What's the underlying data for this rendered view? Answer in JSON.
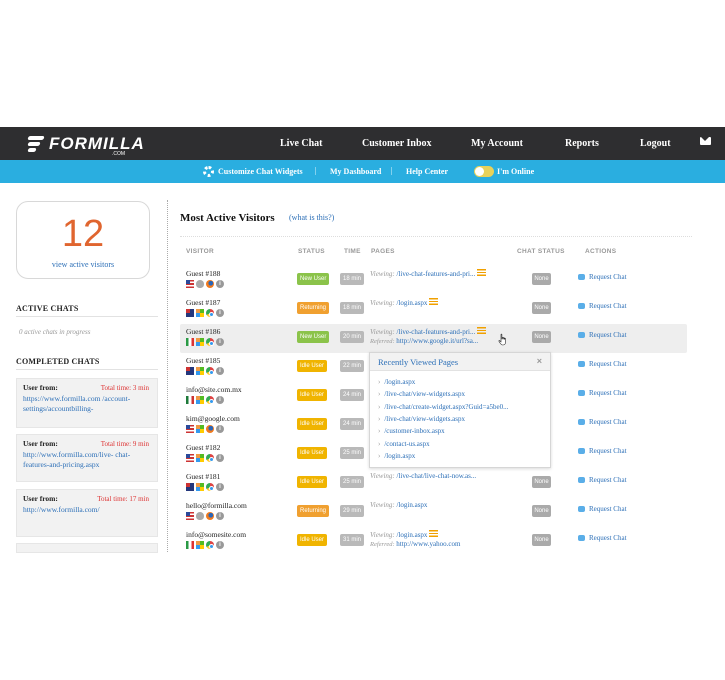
{
  "brand": {
    "name": "FORMILLA",
    "suffix": ".COM"
  },
  "topnav": [
    "Live Chat",
    "Customer Inbox",
    "My Account",
    "Reports",
    "Logout"
  ],
  "subnav": {
    "widgets": "Customize Chat Widgets",
    "dashboard": "My Dashboard",
    "help": "Help Center",
    "online": "I'm Online",
    "online_on": true
  },
  "sidebar": {
    "count": "12",
    "count_link": "view active visitors",
    "active_title": "ACTIVE CHATS",
    "active_empty": "0 active chats in progress",
    "completed_title": "COMPLETED CHATS",
    "completed": [
      {
        "label": "User from:",
        "time": "Total time: 3 min",
        "url": "https://www.formilla.com /account-settings/accountbilling-"
      },
      {
        "label": "User from:",
        "time": "Total time: 9 min",
        "url": "http://www.formilla.com/live- chat-features-and-pricing.aspx"
      },
      {
        "label": "User from:",
        "time": "Total time: 17 min",
        "url": "http://www.formilla.com/"
      }
    ]
  },
  "main": {
    "title": "Most Active Visitors",
    "help_link": "(what is this?)",
    "headers": {
      "visitor": "VISITOR",
      "status": "STATUS",
      "time": "TIME",
      "pages": "PAGES",
      "chat_status": "CHAT STATUS",
      "actions": "ACTIONS"
    },
    "viewing_label": "Viewing:",
    "referred_label": "Referred:",
    "request_label": "Request Chat",
    "rows": [
      {
        "name": "Guest #188",
        "status": "New User",
        "time": "18 min",
        "page": "/live-chat-features-and-pri...",
        "list": true,
        "referred": "",
        "chat": "None",
        "flag": "us",
        "os": "apple",
        "browser": "ff"
      },
      {
        "name": "Guest #187",
        "status": "Returning",
        "time": "18 min",
        "page": "/login.aspx",
        "list": true,
        "referred": "",
        "chat": "None",
        "flag": "au",
        "os": "win",
        "browser": "chrome"
      },
      {
        "name": "Guest #186",
        "status": "New User",
        "time": "20 min",
        "page": "/live-chat-features-and-pri...",
        "list": true,
        "referred": "http://www.google.it/url?sa...",
        "chat": "None",
        "flag": "it",
        "os": "win",
        "browser": "chrome"
      },
      {
        "name": "Guest #185",
        "status": "Idle User",
        "time": "22 min",
        "page": "",
        "list": false,
        "referred": "",
        "chat": "",
        "flag": "au",
        "os": "win",
        "browser": "chrome"
      },
      {
        "name": "info@site.com.mx",
        "status": "Idle User",
        "time": "24 min",
        "page": "",
        "list": false,
        "referred": "",
        "chat": "",
        "flag": "mx",
        "os": "win",
        "browser": "chrome"
      },
      {
        "name": "kim@google.com",
        "status": "Idle User",
        "time": "24 min",
        "page": "",
        "list": false,
        "referred": "",
        "chat": "",
        "flag": "us",
        "os": "win",
        "browser": "ff"
      },
      {
        "name": "Guest #182",
        "status": "Idle User",
        "time": "25 min",
        "page": "",
        "list": false,
        "referred": "",
        "chat": "",
        "flag": "us",
        "os": "win",
        "browser": "chrome"
      },
      {
        "name": "Guest #181",
        "status": "Idle User",
        "time": "25 min",
        "page": "/live-chat/live-chat-now.as...",
        "list": false,
        "referred": "",
        "chat": "None",
        "flag": "au",
        "os": "win",
        "browser": "chrome"
      },
      {
        "name": "hello@formilla.com",
        "status": "Returning",
        "time": "29 min",
        "page": "/login.aspx",
        "list": false,
        "referred": "",
        "chat": "None",
        "flag": "us",
        "os": "apple",
        "browser": "ff"
      },
      {
        "name": "info@somesite.com",
        "status": "Idle User",
        "time": "31 min",
        "page": "/login.aspx",
        "list": true,
        "referred": "http://www.yahoo.com",
        "chat": "None",
        "flag": "it",
        "os": "win",
        "browser": "chrome"
      }
    ],
    "popup": {
      "title": "Recently Viewed Pages",
      "close": "×",
      "items": [
        "/login.aspx",
        "/live-chat/view-widgets.aspx",
        "/live-chat/create-widget.aspx?Guid=a5be0...",
        "/live-chat/view-widgets.aspx",
        "/customer-inbox.aspx",
        "/contact-us.aspx",
        "/login.aspx"
      ]
    }
  }
}
